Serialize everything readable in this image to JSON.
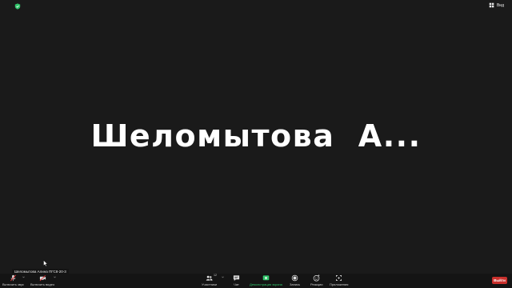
{
  "top": {
    "view_label": "Вид"
  },
  "main": {
    "speaker_name": "Шеломытова  А..."
  },
  "participant": {
    "name_tag": "Шеломытова Алина ПГС8-20-3"
  },
  "toolbar": {
    "mute_label": "Включить звук",
    "video_label": "Включить видео",
    "participants_label": "Участники",
    "participants_count": "12",
    "chat_label": "Чат",
    "share_label": "Демонстрация экрана",
    "record_label": "Запись",
    "reactions_label": "Реакции",
    "apps_label": "Приложения",
    "end_label": "Выйти"
  },
  "colors": {
    "background": "#1a1a1a",
    "share_green": "#31c46a",
    "end_red": "#c9302c",
    "mute_red": "#e5383b",
    "shield_green": "#31c46a"
  }
}
